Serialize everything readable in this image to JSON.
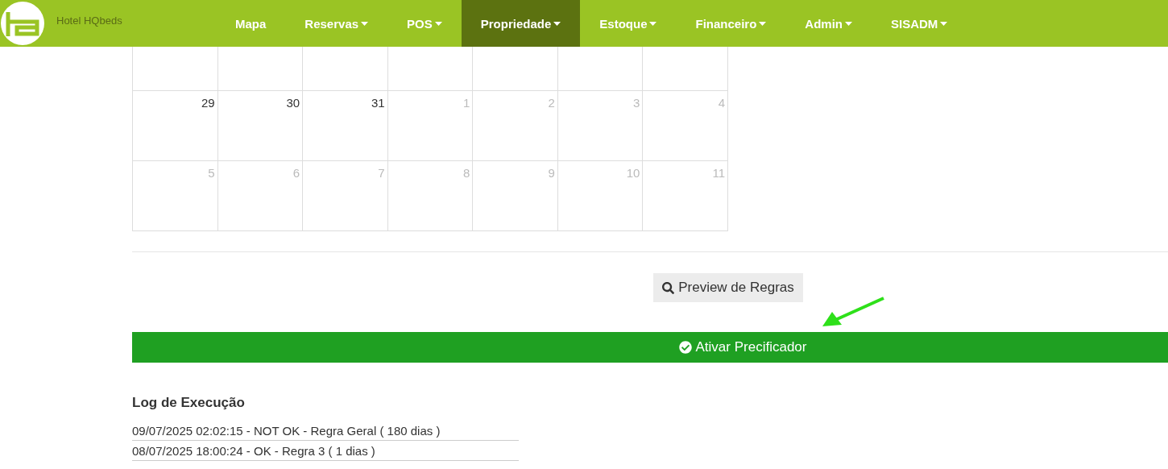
{
  "brand": {
    "name": "Hotel HQbeds"
  },
  "nav": [
    {
      "label": "Mapa",
      "dropdown": false,
      "selected": false
    },
    {
      "label": "Reservas",
      "dropdown": true,
      "selected": false
    },
    {
      "label": "POS",
      "dropdown": true,
      "selected": false
    },
    {
      "label": "Propriedade",
      "dropdown": true,
      "selected": true
    },
    {
      "label": "Estoque",
      "dropdown": true,
      "selected": false
    },
    {
      "label": "Financeiro",
      "dropdown": true,
      "selected": false
    },
    {
      "label": "Admin",
      "dropdown": true,
      "selected": false
    },
    {
      "label": "SISADM",
      "dropdown": true,
      "selected": false
    }
  ],
  "calendar": {
    "weeks": [
      [
        {
          "day": "29",
          "other_month": false
        },
        {
          "day": "30",
          "other_month": false
        },
        {
          "day": "31",
          "other_month": false
        },
        {
          "day": "1",
          "other_month": true
        },
        {
          "day": "2",
          "other_month": true
        },
        {
          "day": "3",
          "other_month": true
        },
        {
          "day": "4",
          "other_month": true
        }
      ],
      [
        {
          "day": "5",
          "other_month": true
        },
        {
          "day": "6",
          "other_month": true
        },
        {
          "day": "7",
          "other_month": true
        },
        {
          "day": "8",
          "other_month": true
        },
        {
          "day": "9",
          "other_month": true
        },
        {
          "day": "10",
          "other_month": true
        },
        {
          "day": "11",
          "other_month": true
        }
      ]
    ]
  },
  "preview_button": {
    "label": "Preview de Regras"
  },
  "activate_button": {
    "label": "Ativar Precificador"
  },
  "log": {
    "title": "Log de Execução",
    "entries": [
      "09/07/2025 02:02:15 - NOT OK - Regra Geral ( 180 dias )",
      "08/07/2025 18:00:24 - OK - Regra 3 ( 1 dias )"
    ]
  }
}
